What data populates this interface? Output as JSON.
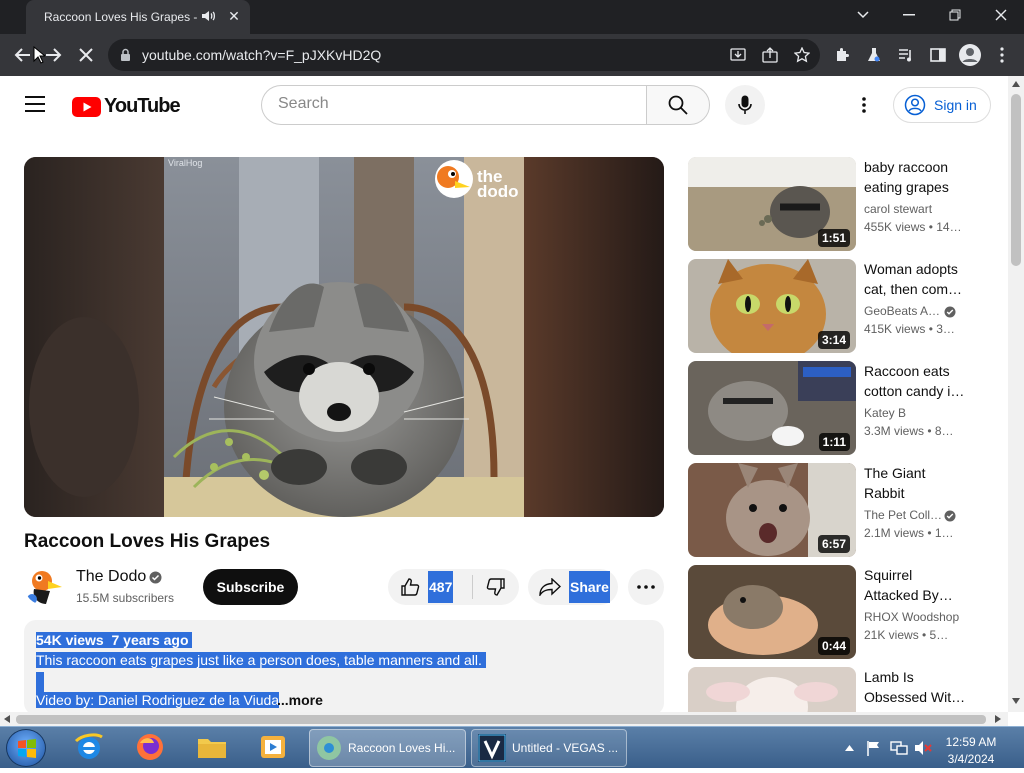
{
  "browser": {
    "tab_title": "Raccoon Loves His Grapes -",
    "tab_close": "✕",
    "url": "youtube.com/watch?v=F_pJXKvHD2Q"
  },
  "youtube": {
    "logo_text": "YouTube",
    "search_placeholder": "Search",
    "sign_in": "Sign in"
  },
  "video": {
    "watermark_source": "ViralHog",
    "watermark_brand_line1": "the",
    "watermark_brand_line2": "dodo",
    "title": "Raccoon Loves His Grapes",
    "channel_name": "The Dodo",
    "subscribers": "15.5M subscribers",
    "subscribe_label": "Subscribe",
    "likes": "487",
    "share_label": "Share",
    "description": {
      "stats": "54K views  7 years ago ",
      "line1": "This raccoon eats grapes just like a person does, table manners and all. ",
      "line2": "Video by: Daniel Rodriguez de la Viuda",
      "more": "...more"
    }
  },
  "recommendations": [
    {
      "title": "baby raccoon eating grapes",
      "channel": "carol stewart",
      "meta": "455K views  • 14…",
      "duration": "1:51",
      "verified": false
    },
    {
      "title": "Woman adopts cat, then com…",
      "channel": "GeoBeats A…",
      "meta": "415K views  • 3…",
      "duration": "3:14",
      "verified": true
    },
    {
      "title": "Raccoon eats cotton candy i…",
      "channel": "Katey B",
      "meta": "3.3M views  • 8…",
      "duration": "1:11",
      "verified": false
    },
    {
      "title": "The Giant Rabbit",
      "channel": "The Pet Coll…",
      "meta": "2.1M views  • 1…",
      "duration": "6:57",
      "verified": true
    },
    {
      "title": "Squirrel Attacked By…",
      "channel": "RHOX Woodshop",
      "meta": "21K views  • 5…",
      "duration": "0:44",
      "verified": false
    },
    {
      "title": "Lamb Is Obsessed Wit…",
      "channel": "",
      "meta": "",
      "duration": "",
      "verified": false
    }
  ],
  "taskbar": {
    "task1": "Raccoon Loves Hi...",
    "task2": "Untitled - VEGAS ...",
    "time": "12:59 AM",
    "date": "3/4/2024"
  },
  "colors": {
    "youtube_red": "#ff0000",
    "selection_blue": "#2f6fdb",
    "link_blue": "#065fd4"
  }
}
